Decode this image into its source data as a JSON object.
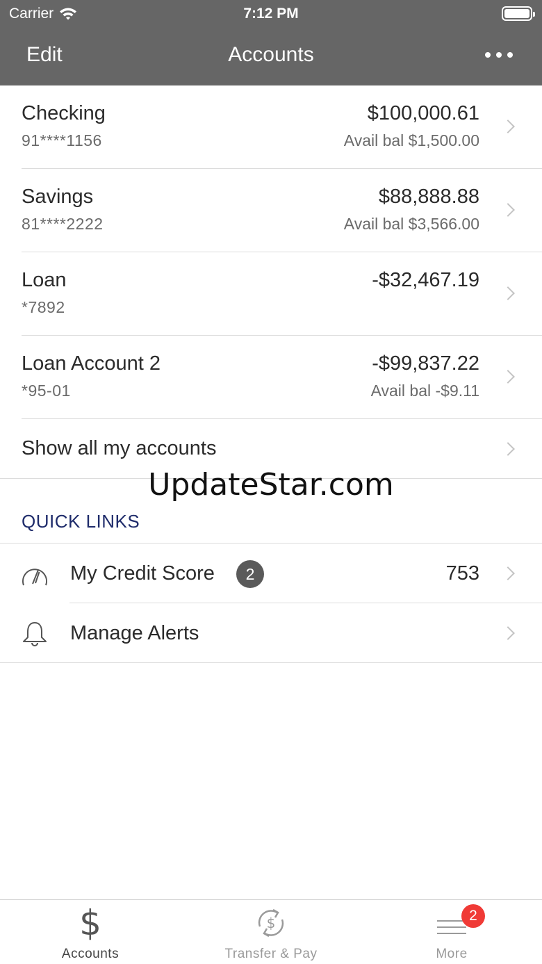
{
  "status_bar": {
    "carrier": "Carrier",
    "time": "7:12 PM"
  },
  "nav": {
    "edit_label": "Edit",
    "title": "Accounts",
    "more_icon": "ellipsis-icon"
  },
  "accounts": [
    {
      "name": "Checking",
      "number": "91****1156",
      "balance": "$100,000.61",
      "available": "Avail bal $1,500.00"
    },
    {
      "name": "Savings",
      "number": "81****2222",
      "balance": "$88,888.88",
      "available": "Avail bal $3,566.00"
    },
    {
      "name": "Loan",
      "number": "*7892",
      "balance": "-$32,467.19",
      "available": ""
    },
    {
      "name": "Loan Account 2",
      "number": "*95-01",
      "balance": "-$99,837.22",
      "available": "Avail bal -$9.11"
    }
  ],
  "show_all": {
    "label": "Show all my accounts"
  },
  "watermark": "UpdateStar.com",
  "quick_links": {
    "header": "QUICK LINKS",
    "items": [
      {
        "label": "My Credit Score",
        "badge": "2",
        "value": "753",
        "icon": "gauge-icon"
      },
      {
        "label": "Manage Alerts",
        "icon": "bell-icon"
      }
    ]
  },
  "tab_bar": {
    "tabs": [
      {
        "label": "Accounts",
        "icon": "dollar-icon",
        "active": true
      },
      {
        "label": "Transfer & Pay",
        "icon": "transfer-dollar-icon",
        "active": false
      },
      {
        "label": "More",
        "icon": "menu-lines-icon",
        "badge": "2",
        "active": false
      }
    ]
  },
  "colors": {
    "header_bg": "#666666",
    "quick_links_header": "#1f2c6b",
    "badge_red": "#f03a36",
    "badge_gray": "#5a5a5a"
  }
}
